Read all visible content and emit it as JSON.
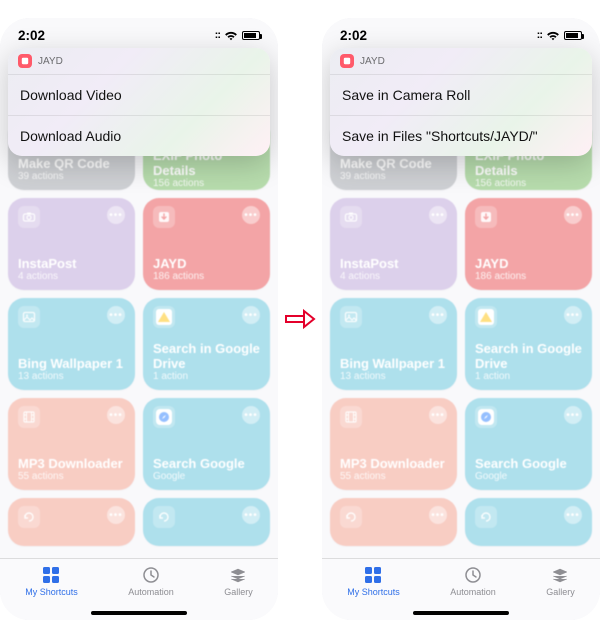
{
  "status": {
    "time": "2:02",
    "icons": {
      "cell": "::",
      "wifi": "wifi",
      "batt": "batt"
    }
  },
  "sheet": {
    "appName": "JAYD"
  },
  "left": {
    "options": [
      "Download Video",
      "Download Audio"
    ]
  },
  "right": {
    "options": [
      "Save in Camera Roll",
      "Save in Files \"Shortcuts/JAYD/\""
    ]
  },
  "tiles": [
    {
      "name": "Make QR Code",
      "sub": "39 actions",
      "color": "#9da1a8"
    },
    {
      "name": "EXIF Photo Details",
      "sub": "156 actions",
      "color": "#6eb85a"
    },
    {
      "name": "InstaPost",
      "sub": "4 actions",
      "color": "#b9a0d6"
    },
    {
      "name": "JAYD",
      "sub": "186 actions",
      "color": "#e7494c"
    },
    {
      "name": "Bing Wallpaper 1",
      "sub": "13 actions",
      "color": "#5cc0d9"
    },
    {
      "name": "Search in Google Drive",
      "sub": "1 action",
      "color": "#5cc0d9"
    },
    {
      "name": "MP3 Downloader",
      "sub": "55 actions",
      "color": "#f19a87"
    },
    {
      "name": "Search Google",
      "sub": "Google",
      "color": "#5cc0d9"
    }
  ],
  "tileIcons": [
    "qr",
    "info",
    "camera",
    "download",
    "image",
    "gdrive",
    "film",
    "safari"
  ],
  "tabs": {
    "shortcuts": "My Shortcuts",
    "automation": "Automation",
    "gallery": "Gallery"
  }
}
